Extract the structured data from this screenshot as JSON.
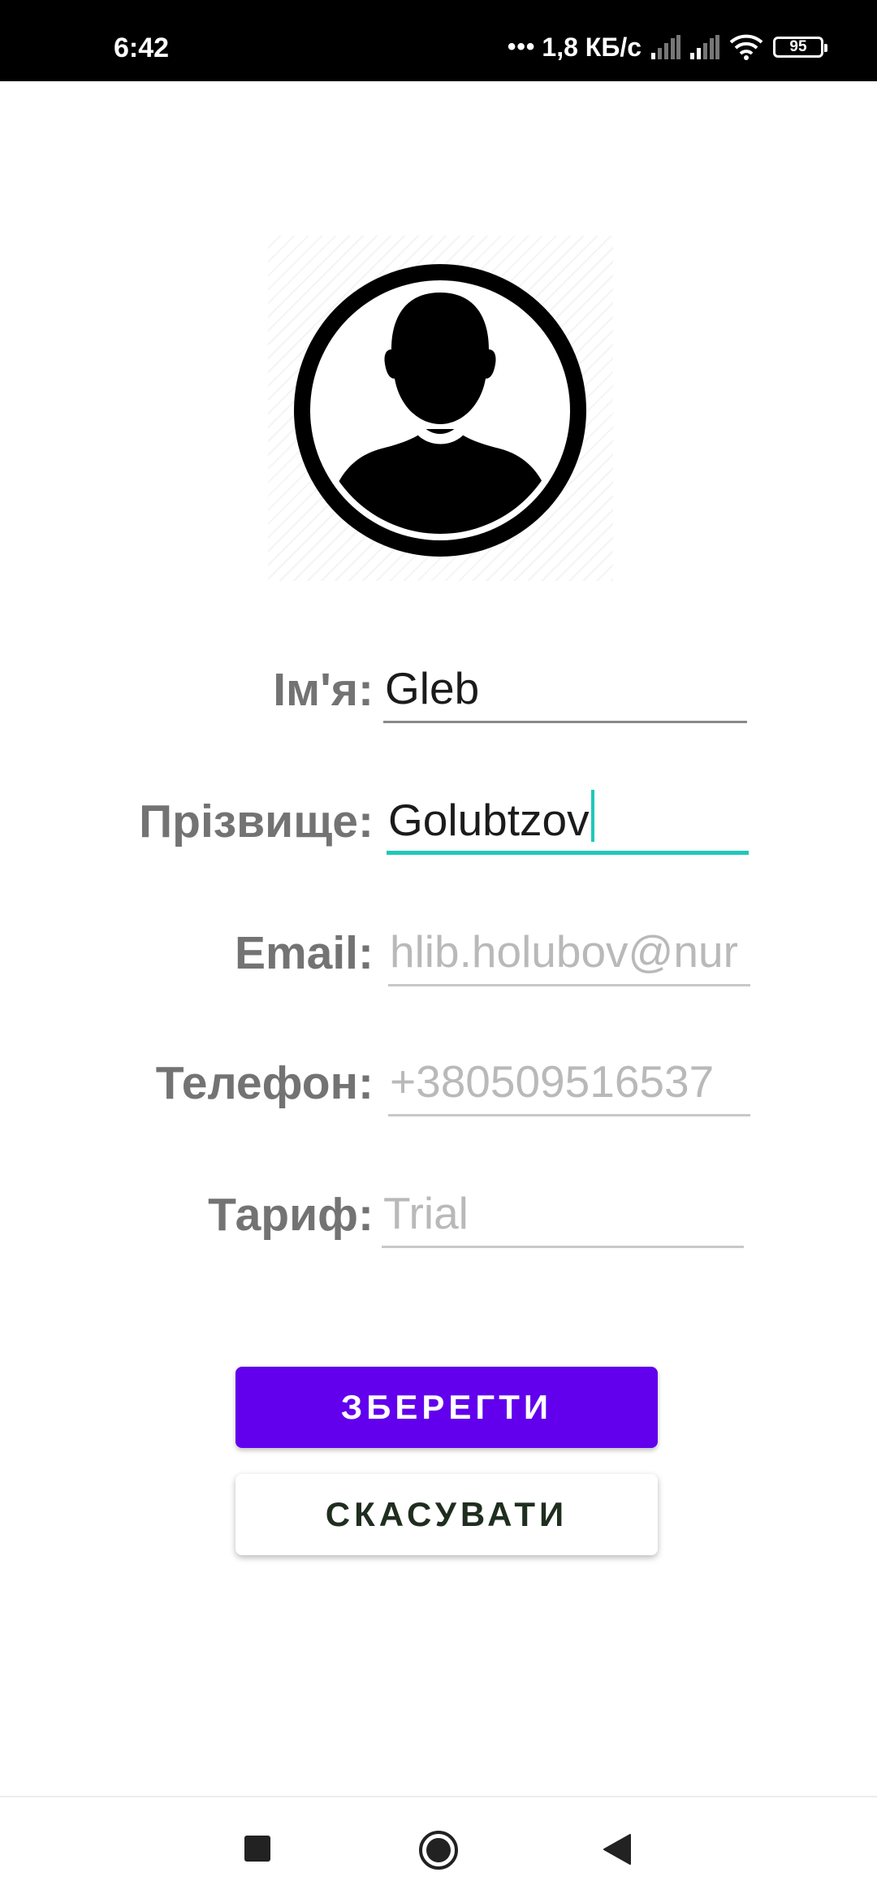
{
  "status_bar": {
    "time": "6:42",
    "more_dots": "•••",
    "net_speed": "1,8 КБ/с",
    "battery": "95"
  },
  "avatar": {
    "icon": "user-profile-icon"
  },
  "form": {
    "first_name": {
      "label": "Ім'я:",
      "value": "Gleb"
    },
    "last_name": {
      "label": "Прізвище:",
      "value": "Golubtzov"
    },
    "email": {
      "label": "Email:",
      "placeholder": "hlib.holubov@nur"
    },
    "phone": {
      "label": "Телефон:",
      "placeholder": "+380509516537"
    },
    "tariff": {
      "label": "Тариф:",
      "placeholder": "Trial"
    }
  },
  "buttons": {
    "save": "ЗБЕРЕГТИ",
    "cancel": "СКАСУВАТИ"
  },
  "colors": {
    "accent": "#6200ee",
    "focus": "#1fc8b8"
  }
}
